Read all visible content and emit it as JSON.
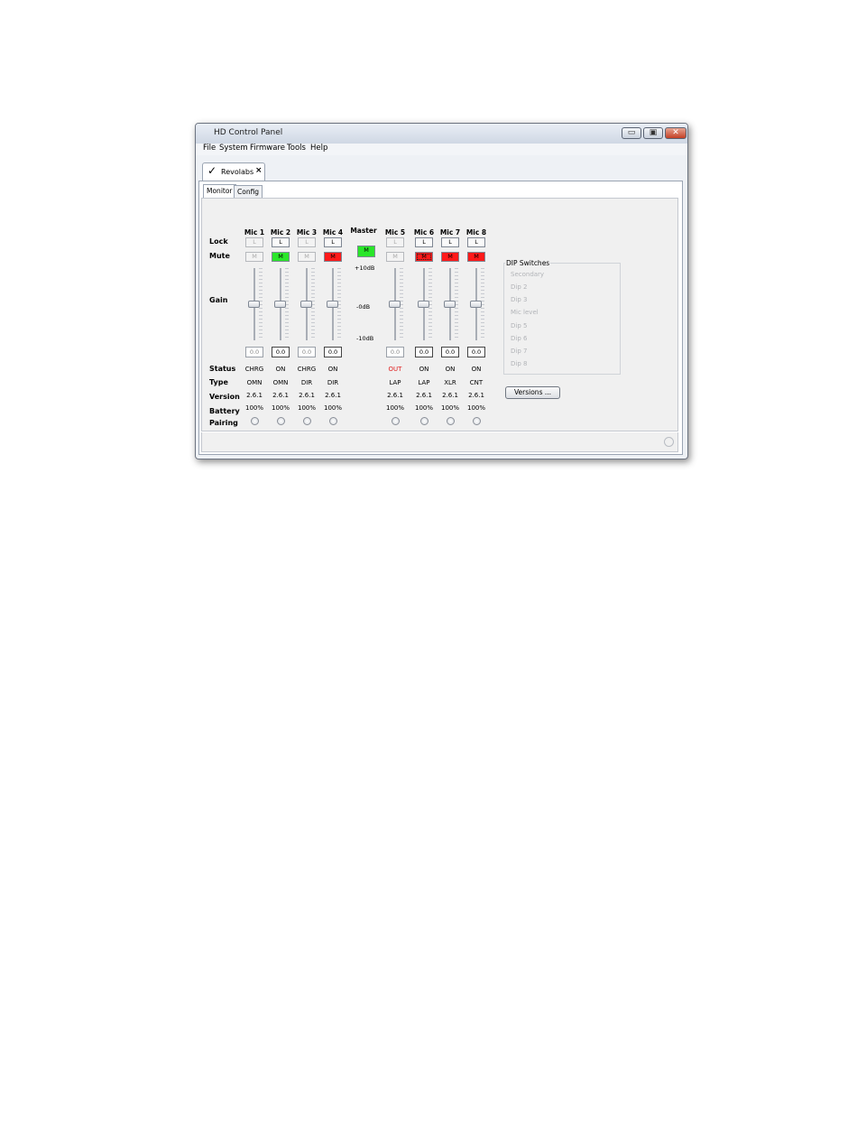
{
  "window": {
    "title": "HD Control Panel",
    "minimize": "▭",
    "maximize": "▣",
    "close": "✕"
  },
  "menu": [
    "File",
    "System",
    "Firmware",
    "Tools",
    "Help"
  ],
  "doc_tab": {
    "label": "Revolabs",
    "check": "✓",
    "close": "×"
  },
  "sub_tabs": [
    "Monitor",
    "Config"
  ],
  "row_labels": {
    "lock": "Lock",
    "mute": "Mute",
    "gain": "Gain",
    "status": "Status",
    "type": "Type",
    "version": "Version",
    "battery": "Battery",
    "pairing": "Pairing"
  },
  "master": {
    "label": "Master",
    "mute": "M",
    "scale_top": "+10dB",
    "scale_mid": "-0dB",
    "scale_bot": "-10dB"
  },
  "mics": [
    {
      "name": "Mic 1",
      "lock": "L",
      "mute": "M",
      "gain": "0.0",
      "status": "CHRG",
      "type": "OMN",
      "version": "2.6.1",
      "battery": "100%"
    },
    {
      "name": "Mic 2",
      "lock": "L",
      "mute": "M",
      "gain": "0.0",
      "status": "ON",
      "type": "OMN",
      "version": "2.6.1",
      "battery": "100%"
    },
    {
      "name": "Mic 3",
      "lock": "L",
      "mute": "M",
      "gain": "0.0",
      "status": "CHRG",
      "type": "DIR",
      "version": "2.6.1",
      "battery": "100%"
    },
    {
      "name": "Mic 4",
      "lock": "L",
      "mute": "M",
      "gain": "0.0",
      "status": "ON",
      "type": "DIR",
      "version": "2.6.1",
      "battery": "100%"
    },
    {
      "name": "Mic 5",
      "lock": "L",
      "mute": "M",
      "gain": "0.0",
      "status": "OUT",
      "type": "LAP",
      "version": "2.6.1",
      "battery": "100%"
    },
    {
      "name": "Mic 6",
      "lock": "L",
      "mute": "M",
      "gain": "0.0",
      "status": "ON",
      "type": "LAP",
      "version": "2.6.1",
      "battery": "100%"
    },
    {
      "name": "Mic 7",
      "lock": "L",
      "mute": "M",
      "gain": "0.0",
      "status": "ON",
      "type": "XLR",
      "version": "2.6.1",
      "battery": "100%"
    },
    {
      "name": "Mic 8",
      "lock": "L",
      "mute": "M",
      "gain": "0.0",
      "status": "ON",
      "type": "CNT",
      "version": "2.6.1",
      "battery": "100%"
    }
  ],
  "dip_switches": {
    "title": "DIP Switches",
    "items": [
      "Secondary",
      "Dip 2",
      "Dip 3",
      "Mic level",
      "Dip 5",
      "Dip 6",
      "Dip 7",
      "Dip 8"
    ]
  },
  "versions_button": "Versions ...",
  "colors": {
    "mute_on_green": "#29e629",
    "mute_on_red": "#ff1a1a",
    "status_out": "#e02020"
  }
}
